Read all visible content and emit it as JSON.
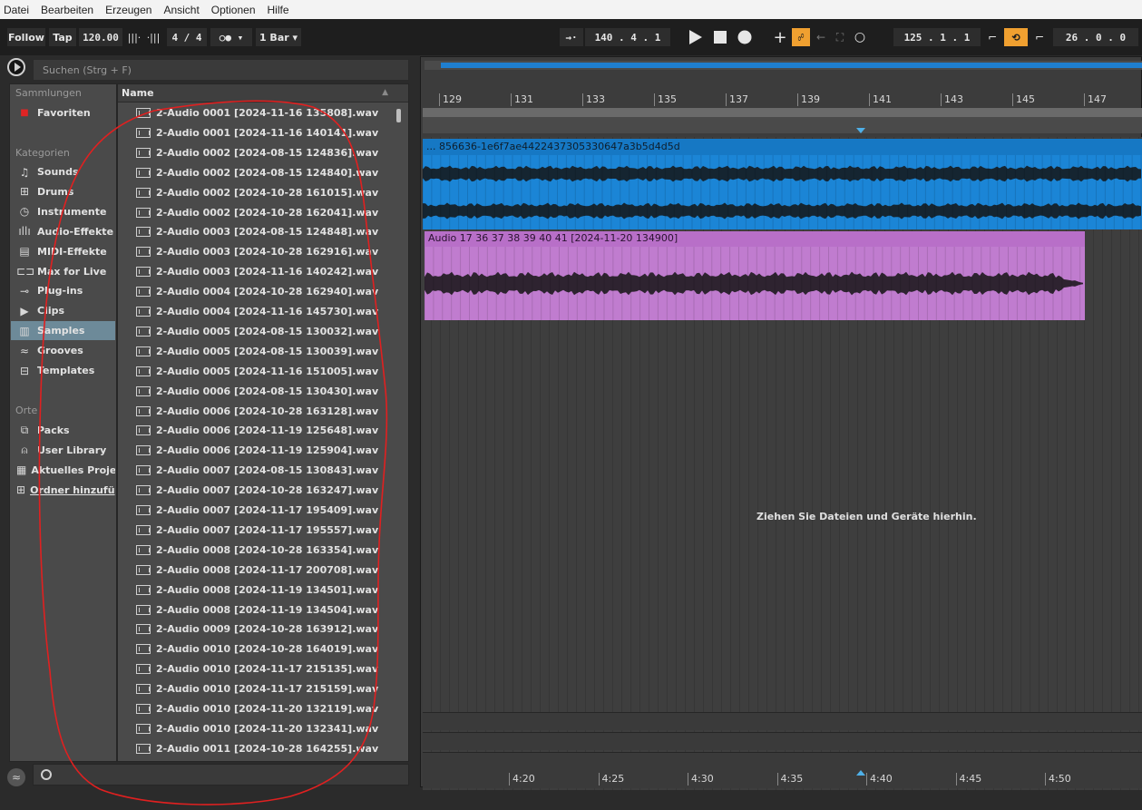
{
  "menu": [
    "Datei",
    "Bearbeiten",
    "Erzeugen",
    "Ansicht",
    "Optionen",
    "Hilfe"
  ],
  "transport": {
    "follow": "Follow",
    "tap": "Tap",
    "tempo": "120.00",
    "signature": "4 / 4",
    "metronome": "○●",
    "quantize": "1 Bar",
    "song_position": "140 .  4 .  1",
    "loop_start": "125 .  1 .  1",
    "loop_length": "26 .  0 .  0"
  },
  "browser": {
    "search_placeholder": "Suchen (Strg + F)",
    "collections_header": "Sammlungen",
    "categories_header": "Kategorien",
    "places_header": "Orte",
    "column_name": "Name",
    "collections": [
      {
        "label": "Favoriten",
        "icon": "red-square-icon"
      }
    ],
    "categories": [
      {
        "label": "Sounds",
        "icon": "note-icon"
      },
      {
        "label": "Drums",
        "icon": "drum-grid-icon"
      },
      {
        "label": "Instrumente",
        "icon": "clock-icon"
      },
      {
        "label": "Audio-Effekte",
        "icon": "audio-fx-icon"
      },
      {
        "label": "MIDI-Effekte",
        "icon": "midi-fx-icon"
      },
      {
        "label": "Max for Live",
        "icon": "max-icon"
      },
      {
        "label": "Plug-ins",
        "icon": "plugin-icon"
      },
      {
        "label": "Clips",
        "icon": "clip-icon"
      },
      {
        "label": "Samples",
        "icon": "sample-icon",
        "selected": true
      },
      {
        "label": "Grooves",
        "icon": "groove-icon"
      },
      {
        "label": "Templates",
        "icon": "template-icon"
      }
    ],
    "places": [
      {
        "label": "Packs",
        "icon": "packs-icon"
      },
      {
        "label": "User Library",
        "icon": "user-icon"
      },
      {
        "label": "Aktuelles Proje",
        "icon": "project-icon"
      },
      {
        "label": "Ordner hinzufüg",
        "icon": "add-folder-icon"
      }
    ],
    "files": [
      "2-Audio 0001 [2024-11-16 135808].wav",
      "2-Audio 0001 [2024-11-16 140141].wav",
      "2-Audio 0002 [2024-08-15 124836].wav",
      "2-Audio 0002 [2024-08-15 124840].wav",
      "2-Audio 0002 [2024-10-28 161015].wav",
      "2-Audio 0002 [2024-10-28 162041].wav",
      "2-Audio 0003 [2024-08-15 124848].wav",
      "2-Audio 0003 [2024-10-28 162916].wav",
      "2-Audio 0003 [2024-11-16 140242].wav",
      "2-Audio 0004 [2024-10-28 162940].wav",
      "2-Audio 0004 [2024-11-16 145730].wav",
      "2-Audio 0005 [2024-08-15 130032].wav",
      "2-Audio 0005 [2024-08-15 130039].wav",
      "2-Audio 0005 [2024-11-16 151005].wav",
      "2-Audio 0006 [2024-08-15 130430].wav",
      "2-Audio 0006 [2024-10-28 163128].wav",
      "2-Audio 0006 [2024-11-19 125648].wav",
      "2-Audio 0006 [2024-11-19 125904].wav",
      "2-Audio 0007 [2024-08-15 130843].wav",
      "2-Audio 0007 [2024-10-28 163247].wav",
      "2-Audio 0007 [2024-11-17 195409].wav",
      "2-Audio 0007 [2024-11-17 195557].wav",
      "2-Audio 0008 [2024-10-28 163354].wav",
      "2-Audio 0008 [2024-11-17 200708].wav",
      "2-Audio 0008 [2024-11-19 134501].wav",
      "2-Audio 0008 [2024-11-19 134504].wav",
      "2-Audio 0009 [2024-10-28 163912].wav",
      "2-Audio 0010 [2024-10-28 164019].wav",
      "2-Audio 0010 [2024-11-17 215135].wav",
      "2-Audio 0010 [2024-11-17 215159].wav",
      "2-Audio 0010 [2024-11-20 132119].wav",
      "2-Audio 0010 [2024-11-20 132341].wav",
      "2-Audio 0011 [2024-10-28 164255].wav"
    ]
  },
  "arrangement": {
    "bars": [
      "129",
      "131",
      "133",
      "135",
      "137",
      "139",
      "141",
      "143",
      "145",
      "147"
    ],
    "times": [
      "4:20",
      "4:25",
      "4:30",
      "4:35",
      "4:40",
      "4:45",
      "4:50"
    ],
    "clip1_name": "... 856636-1e6f7ae4422437305330647a3b5d4d5d",
    "clip2_name": "Audio 17 36 37 38 39 40 41 [2024-11-20 134900]",
    "drop_hint": "Ziehen Sie Dateien und Geräte hierhin.",
    "colors": {
      "clip1": "#1b85d6",
      "clip2": "#c07ccf",
      "accent": "#f0a030"
    }
  }
}
